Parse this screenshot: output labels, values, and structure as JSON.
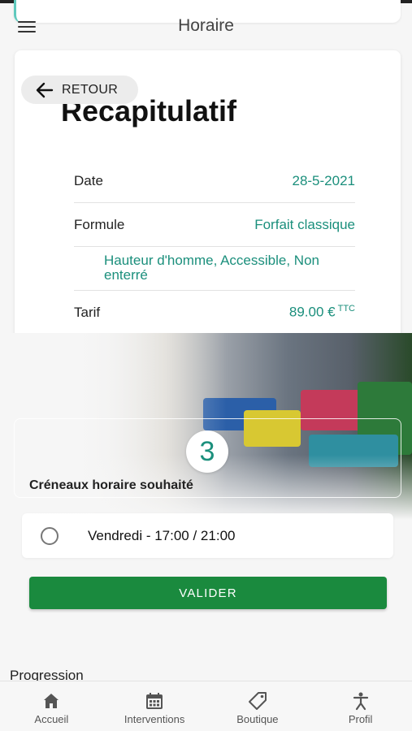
{
  "header": {
    "title": "Horaire",
    "menu_icon": "hamburger-menu-icon"
  },
  "recap": {
    "back_label": "RETOUR",
    "title": "Recapitulatif",
    "rows": {
      "date": {
        "label": "Date",
        "value": "28-5-2021"
      },
      "formule": {
        "label": "Formule",
        "value": "Forfait classique",
        "details": "Hauteur d'homme, Accessible, Non enterré"
      },
      "tarif": {
        "label": "Tarif",
        "value": "89.00 €",
        "suffix": "TTC"
      }
    }
  },
  "step": {
    "number": "3",
    "title": "Créneaux horaire souhaité"
  },
  "slots": [
    {
      "label": "Vendredi - 17:00 / 21:00",
      "selected": false
    }
  ],
  "validate_label": "VALIDER",
  "progress_label": "Progression",
  "tabbar": {
    "items": [
      {
        "label": "Accueil",
        "icon": "home-icon"
      },
      {
        "label": "Interventions",
        "icon": "calendar-icon"
      },
      {
        "label": "Boutique",
        "icon": "tag-icon"
      },
      {
        "label": "Profil",
        "icon": "person-icon"
      }
    ]
  },
  "colors": {
    "accent": "#1b8f7c",
    "primary_button": "#1a8a3e"
  }
}
